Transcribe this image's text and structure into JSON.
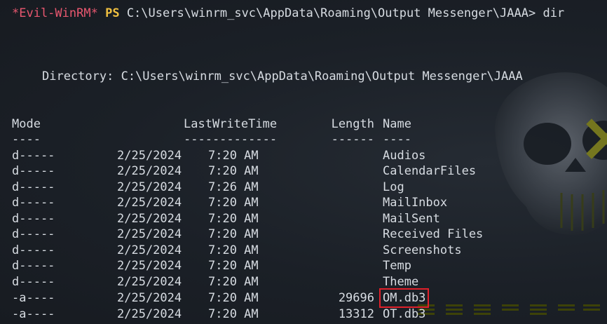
{
  "prompt": {
    "shell": "*Evil-WinRM*",
    "ps": "PS",
    "path": "C:\\Users\\winrm_svc\\AppData\\Roaming\\Output Messenger\\JAAA>",
    "command": "dir"
  },
  "directory_line": "Directory: C:\\Users\\winrm_svc\\AppData\\Roaming\\Output Messenger\\JAAA",
  "headers": {
    "mode": "Mode",
    "last_write_time": "LastWriteTime",
    "length": "Length",
    "name": "Name"
  },
  "separators": {
    "mode": "----",
    "last_write_time": "-------------",
    "length": "------",
    "name": "----"
  },
  "entries": [
    {
      "mode": "d-----",
      "date": "2/25/2024",
      "time": "7:20 AM",
      "length": "",
      "name": "Audios"
    },
    {
      "mode": "d-----",
      "date": "2/25/2024",
      "time": "7:20 AM",
      "length": "",
      "name": "CalendarFiles"
    },
    {
      "mode": "d-----",
      "date": "2/25/2024",
      "time": "7:26 AM",
      "length": "",
      "name": "Log"
    },
    {
      "mode": "d-----",
      "date": "2/25/2024",
      "time": "7:20 AM",
      "length": "",
      "name": "MailInbox"
    },
    {
      "mode": "d-----",
      "date": "2/25/2024",
      "time": "7:20 AM",
      "length": "",
      "name": "MailSent"
    },
    {
      "mode": "d-----",
      "date": "2/25/2024",
      "time": "7:20 AM",
      "length": "",
      "name": "Received Files"
    },
    {
      "mode": "d-----",
      "date": "2/25/2024",
      "time": "7:20 AM",
      "length": "",
      "name": "Screenshots"
    },
    {
      "mode": "d-----",
      "date": "2/25/2024",
      "time": "7:20 AM",
      "length": "",
      "name": "Temp"
    },
    {
      "mode": "d-----",
      "date": "2/25/2024",
      "time": "7:20 AM",
      "length": "",
      "name": "Theme"
    },
    {
      "mode": "-a----",
      "date": "2/25/2024",
      "time": "7:20 AM",
      "length": "29696",
      "name": "OM.db3",
      "highlighted": true
    },
    {
      "mode": "-a----",
      "date": "2/25/2024",
      "time": "7:20 AM",
      "length": "13312",
      "name": "OT.db3"
    }
  ],
  "colors": {
    "background": "#1c2129",
    "shell_label": "#e8576f",
    "ps_label": "#f0c040",
    "text": "#d7dce2",
    "highlight_box": "#e0202a"
  },
  "icons": {
    "background_art": "skull-icon"
  }
}
